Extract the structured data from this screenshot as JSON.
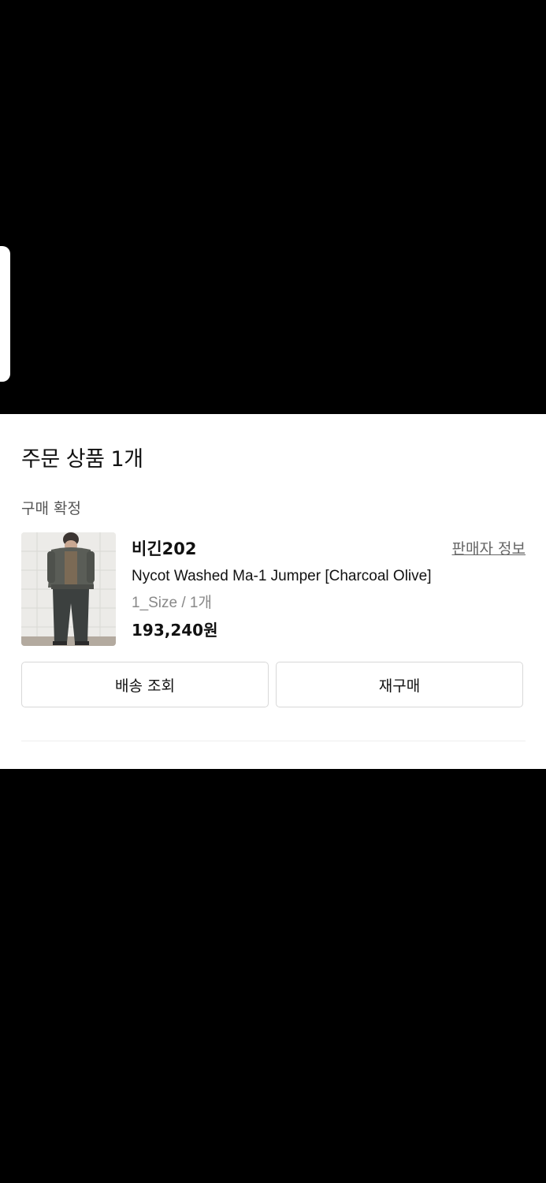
{
  "sheet": {
    "title": "주문 상품 1개",
    "status": "구매 확정"
  },
  "product": {
    "brand": "비긴202",
    "seller_link": "판매자 정보",
    "name": "Nycot Washed Ma-1 Jumper [Charcoal Olive]",
    "option": "1_Size / 1개",
    "price": "193,240원",
    "image_alt": "Nycot Washed Ma-1 Jumper [Charcoal Olive]"
  },
  "actions": {
    "track_label": "배송 조회",
    "reorder_label": "재구매"
  },
  "colors": {
    "background": "#000000",
    "sheet": "#ffffff",
    "text": "#111111",
    "muted": "#888888",
    "border": "#d8d8d8"
  }
}
